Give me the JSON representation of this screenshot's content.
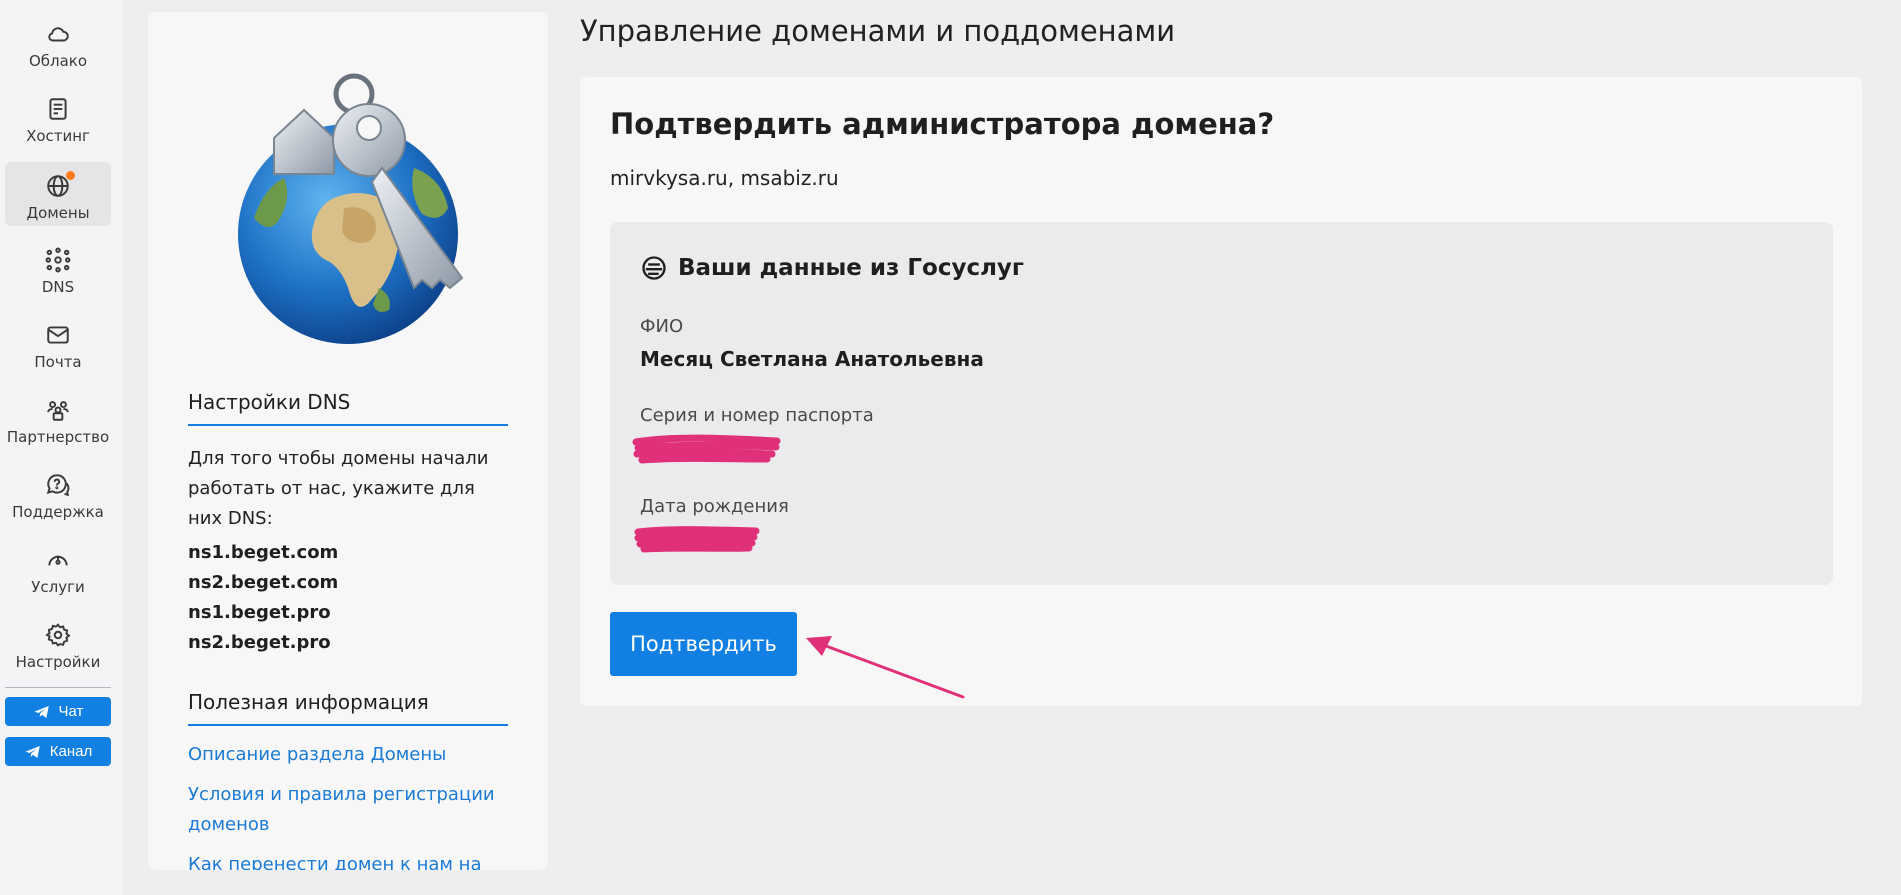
{
  "nav": {
    "items": [
      {
        "label": "Облако",
        "icon": "cloud-icon"
      },
      {
        "label": "Хостинг",
        "icon": "server-icon"
      },
      {
        "label": "Домены",
        "icon": "globe-icon",
        "active": true,
        "badge": true
      },
      {
        "label": "DNS",
        "icon": "dns-network-icon"
      },
      {
        "label": "Почта",
        "icon": "mail-icon"
      },
      {
        "label": "Партнерство",
        "icon": "partners-icon"
      },
      {
        "label": "Поддержка",
        "icon": "support-chat-icon"
      },
      {
        "label": "Услуги",
        "icon": "speedometer-icon"
      },
      {
        "label": "Настройки",
        "icon": "gear-icon"
      }
    ],
    "chat_label": "Чат",
    "channel_label": "Канал"
  },
  "info": {
    "dns_title": "Настройки DNS",
    "dns_text": "Для того чтобы домены начали работать от нас, укажите для них DNS:",
    "ns": [
      "ns1.beget.com",
      "ns2.beget.com",
      "ns1.beget.pro",
      "ns2.beget.pro"
    ],
    "useful_title": "Полезная информация",
    "links": [
      "Описание раздела Домены",
      "Условия и правила регистрации доменов",
      "Как перенести домен к нам на"
    ]
  },
  "main": {
    "page_title": "Управление доменами и поддоменами",
    "card_title": "Подтвердить администратора домена?",
    "domains": "mirvkysa.ru, msabiz.ru",
    "gos_title": "Ваши данные из Госуслуг",
    "fio_label": "ФИО",
    "fio_value": "Месяц Светлана Анатольевна",
    "passport_label": "Серия и номер паспорта",
    "birth_label": "Дата рождения",
    "confirm_label": "Подтвердить"
  },
  "colors": {
    "accent": "#1280e2",
    "annotation": "#e0307a",
    "badge": "#ff7a1a"
  }
}
